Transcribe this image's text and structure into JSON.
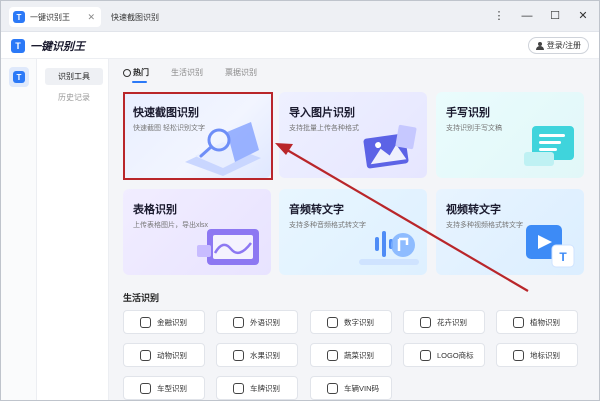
{
  "tabbar": {
    "home_tab": "一键识别王",
    "second_tab": "快速截图识别",
    "logo_letter": "T"
  },
  "header": {
    "app_name": "一键识别王",
    "logo_letter": "T",
    "login_label": "登录/注册"
  },
  "rail": {
    "logo_letter": "T"
  },
  "sidebar": {
    "items": [
      {
        "label": "识别工具",
        "active": true
      },
      {
        "label": "历史记录",
        "active": false
      }
    ]
  },
  "main": {
    "tabs": [
      {
        "label": "热门",
        "active": true
      },
      {
        "label": "生活识别",
        "active": false
      },
      {
        "label": "票据识别",
        "active": false
      }
    ],
    "cards": [
      {
        "title": "快速截图识别",
        "subtitle": "快速截图 轻松识别文字"
      },
      {
        "title": "导入图片识别",
        "subtitle": "支持批量上传各种格式"
      },
      {
        "title": "手写识别",
        "subtitle": "支持识别手写文稿"
      },
      {
        "title": "表格识别",
        "subtitle": "上传表格图片，导出xlsx"
      },
      {
        "title": "音频转文字",
        "subtitle": "支持多种音频格式转文字"
      },
      {
        "title": "视频转文字",
        "subtitle": "支持多种视频格式转文字"
      }
    ],
    "card_icons": {
      "video_letter": "T"
    },
    "life_section_title": "生活识别",
    "life_buttons": [
      "金融识别",
      "外语识别",
      "数字识别",
      "花卉识别",
      "植物识别",
      "动物识别",
      "水果识别",
      "蔬菜识别",
      "LOGO商标",
      "地标识别",
      "车型识别",
      "车牌识别",
      "车辆VIN码"
    ]
  },
  "annotation": {
    "color": "#b9262a"
  },
  "colors": {
    "accent": "#2b79f7"
  }
}
